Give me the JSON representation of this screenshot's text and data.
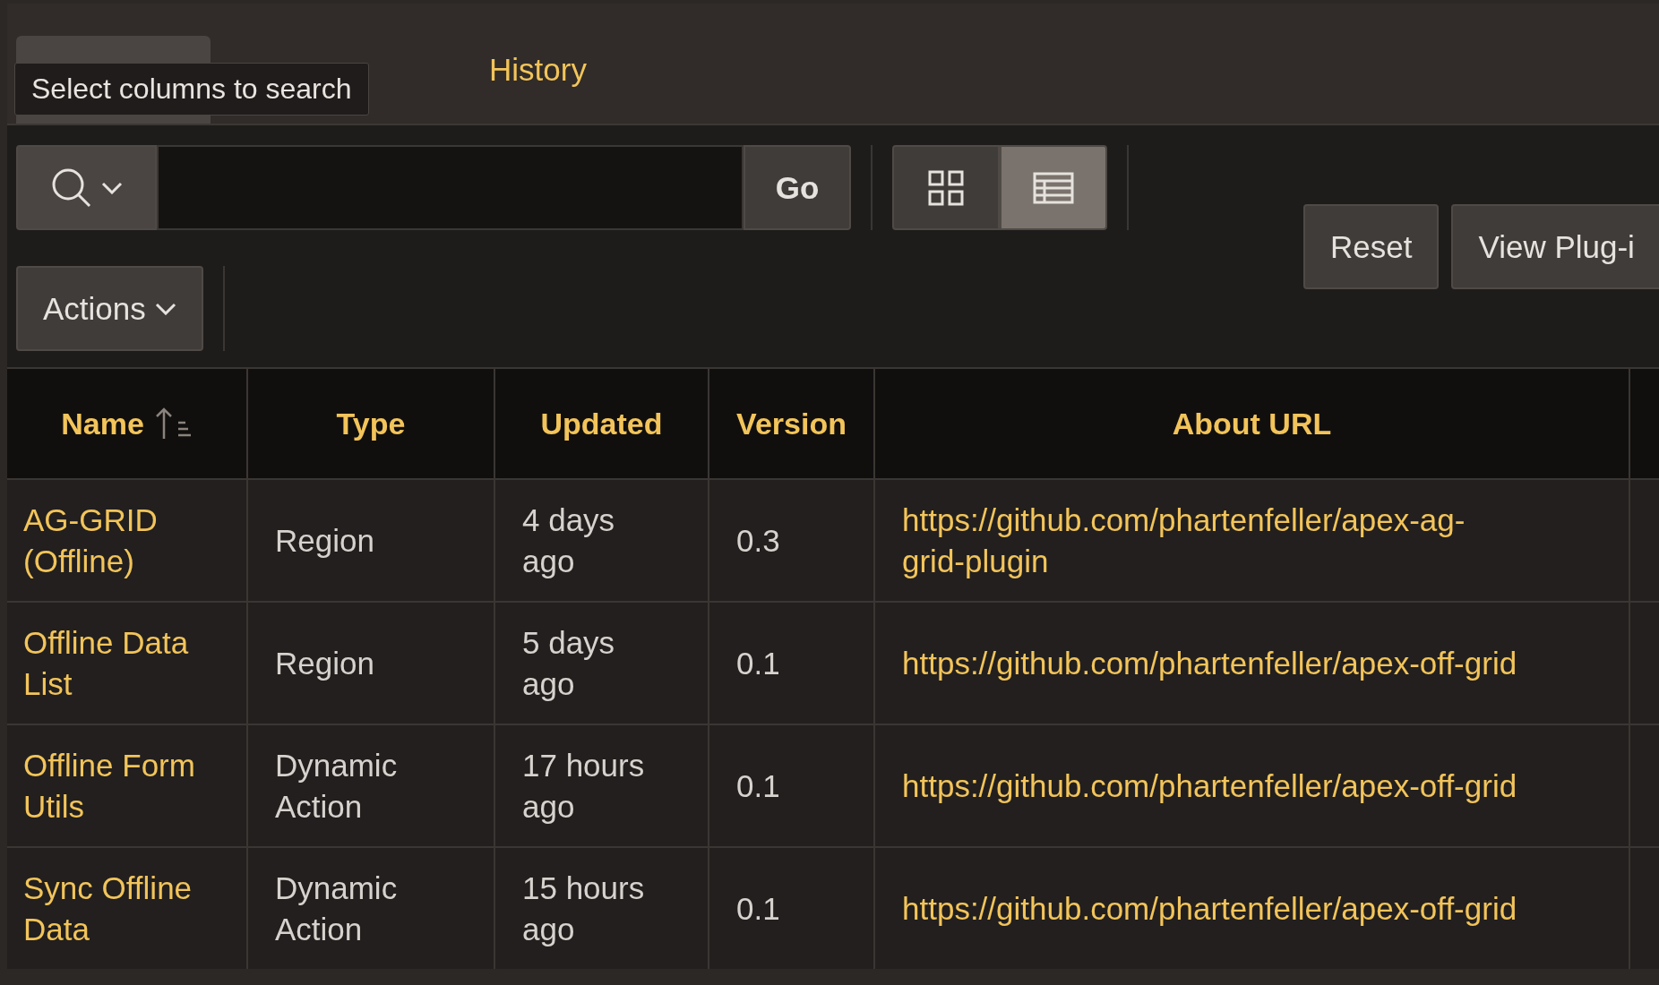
{
  "tabs": [
    {
      "selected": true
    },
    {
      "selected": false
    },
    {
      "label": "History",
      "selected": false
    }
  ],
  "tooltip": {
    "text": "Select columns to search"
  },
  "go_button": "Go",
  "view_toggle": [
    {
      "kind": "grid",
      "selected": false
    },
    {
      "kind": "table",
      "selected": true
    }
  ],
  "actions_button": "Actions",
  "buttons": [
    "Reset",
    "View Plug-i"
  ],
  "table": {
    "columns": [
      {
        "label": "Name",
        "sorted": true
      },
      {
        "label": "Type",
        "sorted": false
      },
      {
        "label": "Updated",
        "sorted": false
      },
      {
        "label": "Version",
        "sorted": false
      },
      {
        "label": "About URL",
        "sorted": false
      }
    ],
    "rows": [
      {
        "name": "AG-GRID (Offline)",
        "type": "Region",
        "updated": "4 days ago",
        "version": "0.3",
        "about_url": "https://github.com/phartenfeller/apex-ag-grid-plugin"
      },
      {
        "name": "Offline Data List",
        "type": "Region",
        "updated": "5 days ago",
        "version": "0.1",
        "about_url": "https://github.com/phartenfeller/apex-off-grid"
      },
      {
        "name": "Offline Form Utils",
        "type": "Dynamic Action",
        "updated": "17 hours ago",
        "version": "0.1",
        "about_url": "https://github.com/phartenfeller/apex-off-grid"
      },
      {
        "name": "Sync Offline Data",
        "type": "Dynamic Action",
        "updated": "15 hours ago",
        "version": "0.1",
        "about_url": "https://github.com/phartenfeller/apex-off-grid"
      }
    ]
  }
}
